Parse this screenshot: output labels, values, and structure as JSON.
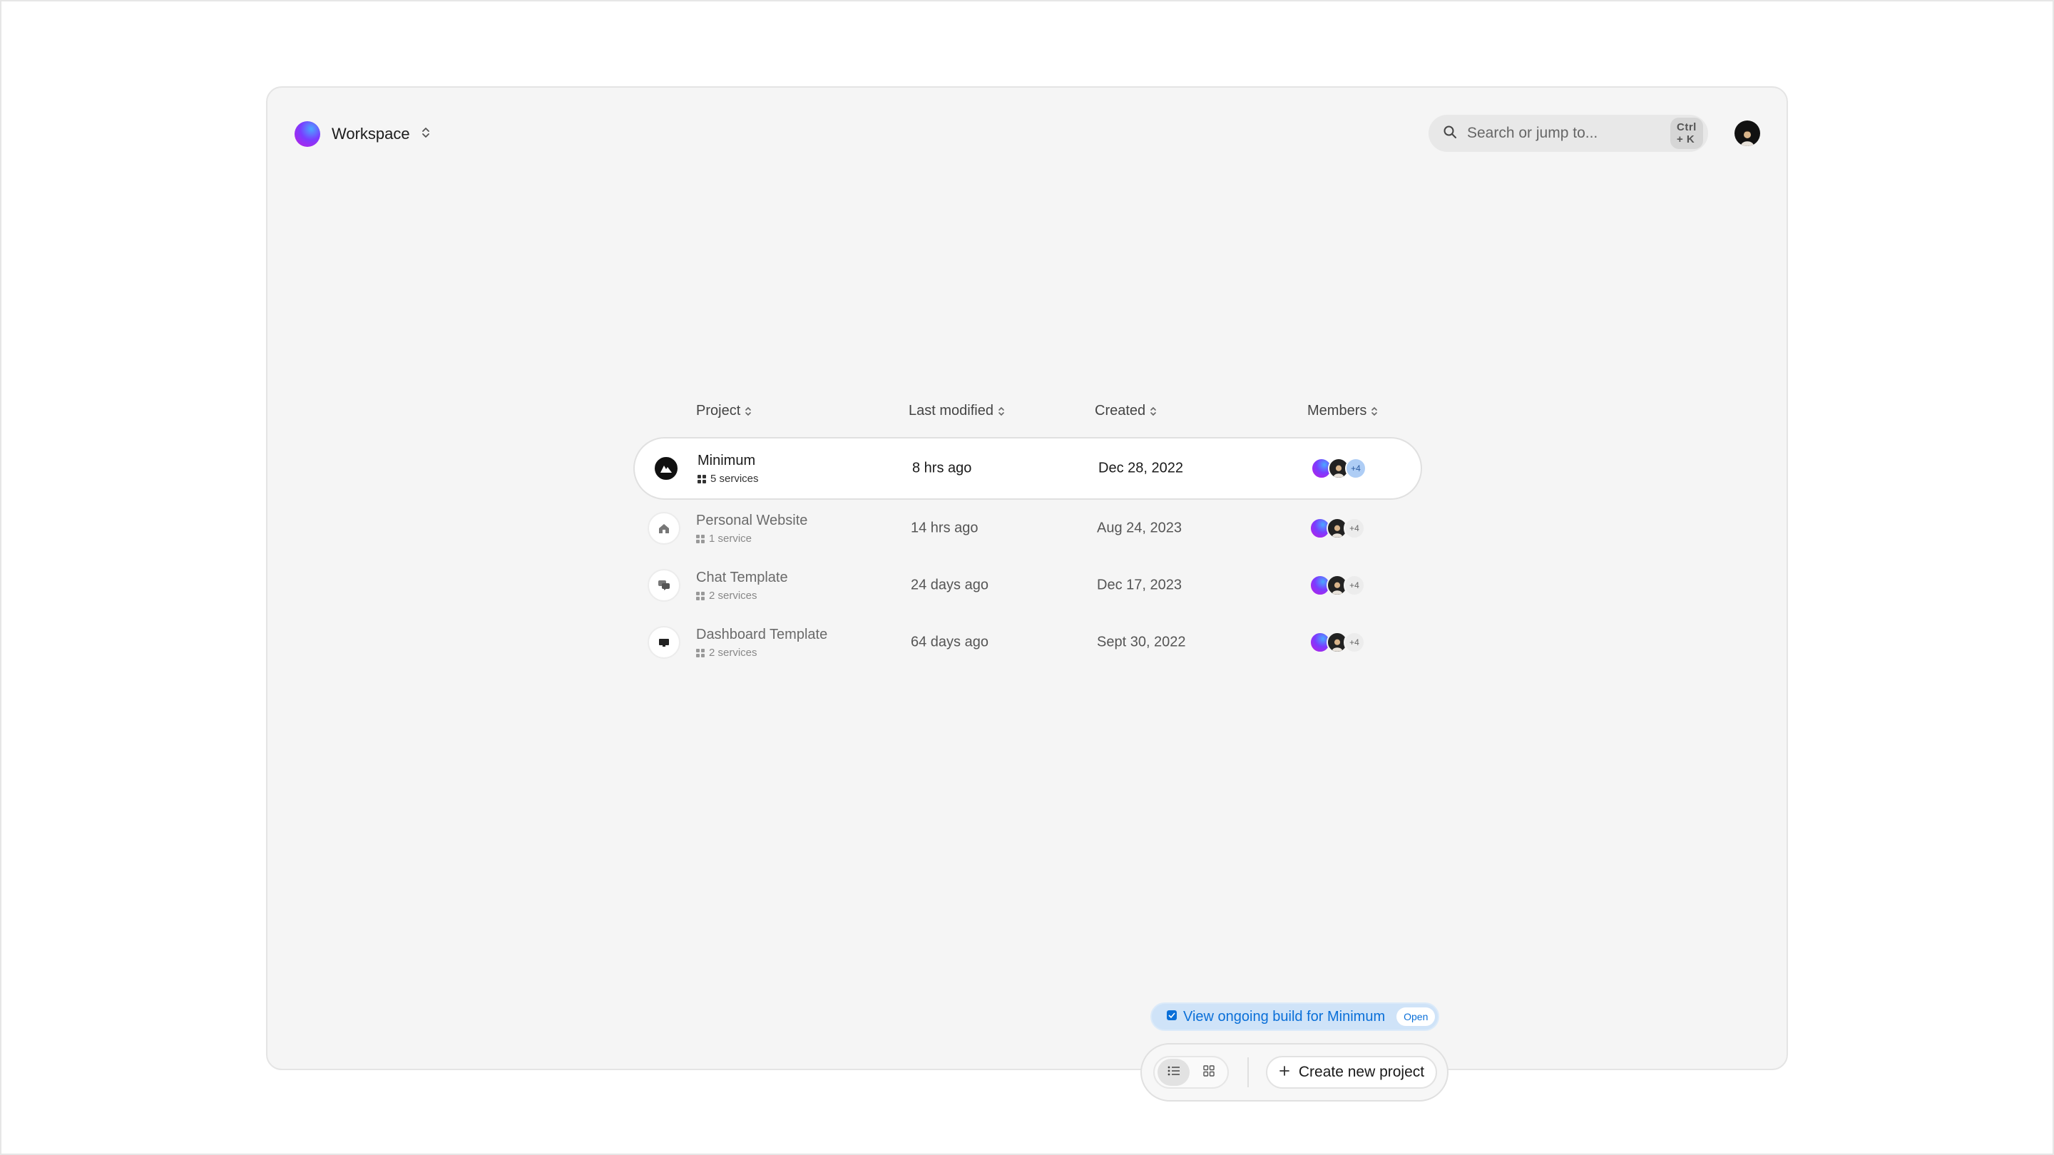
{
  "header": {
    "workspace_name": "Workspace",
    "search_placeholder": "Search or jump to...",
    "search_shortcut": "Ctrl + K"
  },
  "table": {
    "columns": {
      "project": "Project",
      "last_modified": "Last modified",
      "created": "Created",
      "members": "Members"
    },
    "rows": [
      {
        "name": "Minimum",
        "services": "5 services",
        "last_modified": "8 hrs ago",
        "created": "Dec 28, 2022",
        "members_more": "+4",
        "icon": "mountain-icon"
      },
      {
        "name": "Personal Website",
        "services": "1 service",
        "last_modified": "14 hrs ago",
        "created": "Aug 24, 2023",
        "members_more": "+4",
        "icon": "home-icon"
      },
      {
        "name": "Chat Template",
        "services": "2 services",
        "last_modified": "24 days ago",
        "created": "Dec 17, 2023",
        "members_more": "+4",
        "icon": "chat-icon"
      },
      {
        "name": "Dashboard Template",
        "services": "2 services",
        "last_modified": "64 days ago",
        "created": "Sept 30, 2022",
        "members_more": "+4",
        "icon": "monitor-icon"
      }
    ]
  },
  "build_banner": {
    "label": "View ongoing build for Minimum",
    "badge": "Open"
  },
  "toolbar": {
    "create_label": "Create new project"
  },
  "colors": {
    "accent_blue": "#0a6fd8",
    "banner_bg": "#cfe3f8",
    "window_bg": "#f5f5f5"
  }
}
